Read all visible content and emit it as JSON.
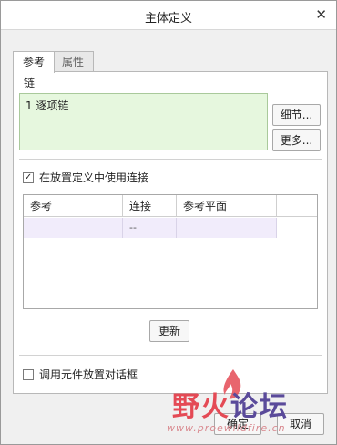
{
  "dialog": {
    "title": "主体定义",
    "close_glyph": "✕"
  },
  "tabs": [
    {
      "label": "参考",
      "active": true
    },
    {
      "label": "属性",
      "active": false
    }
  ],
  "chain": {
    "label": "链",
    "items": [
      "1 逐项链"
    ]
  },
  "buttons": {
    "details": "细节...",
    "more": "更多...",
    "update": "更新",
    "ok": "确定",
    "cancel": "取消"
  },
  "use_connections": {
    "label": "在放置定义中使用连接",
    "checked": true,
    "check_glyph": "✓"
  },
  "table": {
    "headers": [
      "参考",
      "连接",
      "参考平面"
    ],
    "rows": [
      [
        "",
        "--",
        ""
      ]
    ]
  },
  "invoke_placement": {
    "label": "调用元件放置对话框",
    "checked": false
  },
  "watermark": {
    "text_part1": "野火",
    "text_part2": "论坛",
    "url": "www.proewildfire.cn"
  }
}
